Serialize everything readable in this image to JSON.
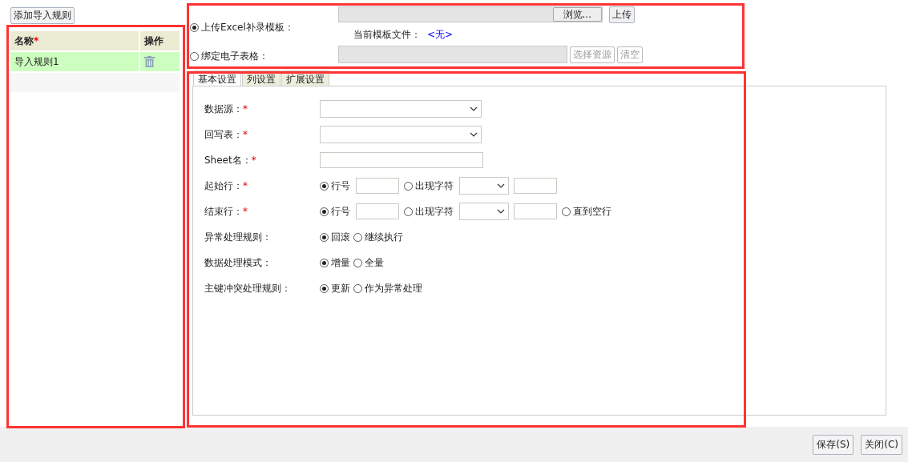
{
  "rules_panel": {
    "add_button": "添加导入规则",
    "columns": [
      {
        "label": "名称",
        "required_mark": "*"
      },
      {
        "label": "操作"
      }
    ],
    "rows": [
      {
        "name": "导入规则1",
        "selected": true
      }
    ]
  },
  "source": {
    "options": [
      {
        "kind": "upload",
        "label": "上传Excel补录模板：",
        "selected": true
      },
      {
        "kind": "bind",
        "label": "绑定电子表格：",
        "selected": false
      }
    ],
    "browse_button": "浏览...",
    "upload_button": "上传",
    "current_file_label": "当前模板文件：",
    "current_file": "<无>",
    "select_button": {
      "label": "选择资源",
      "disabled": true
    },
    "clear_button": {
      "label": "清空",
      "disabled": true
    }
  },
  "tabs": [
    {
      "label": "基本设置",
      "selected": true
    },
    {
      "label": "列设置",
      "selected": false
    },
    {
      "label": "扩展设置",
      "selected": false
    }
  ],
  "fields": [
    {
      "kind": "select",
      "label": "数据源：",
      "required_mark": "*"
    },
    {
      "kind": "select",
      "label": "回写表：",
      "required_mark": "*"
    },
    {
      "kind": "text",
      "label": "Sheet名：",
      "required_mark": "*"
    },
    {
      "kind": "radios",
      "label": "起始行：",
      "required_mark": "*",
      "options": [
        {
          "kind": "number",
          "label": "行号",
          "selected": true
        },
        {
          "kind": "char",
          "label": "出现字符",
          "selected": false
        }
      ]
    },
    {
      "kind": "radios",
      "label": "结束行：",
      "required_mark": "*",
      "options": [
        {
          "kind": "number",
          "label": "行号",
          "selected": true
        },
        {
          "kind": "char",
          "label": "出现字符",
          "selected": false
        },
        {
          "kind": "plain",
          "label": "直到空行",
          "selected": false
        }
      ]
    },
    {
      "kind": "radios",
      "label": "异常处理规则：",
      "options": [
        {
          "kind": "plain",
          "label": "回滚",
          "selected": true
        },
        {
          "kind": "plain",
          "label": "继续执行",
          "selected": false
        }
      ]
    },
    {
      "kind": "radios",
      "label": "数据处理模式：",
      "options": [
        {
          "kind": "plain",
          "label": "增量",
          "selected": true
        },
        {
          "kind": "plain",
          "label": "全量",
          "selected": false
        }
      ]
    },
    {
      "kind": "radios",
      "label": "主键冲突处理规则：",
      "options": [
        {
          "kind": "plain",
          "label": "更新",
          "selected": true
        },
        {
          "kind": "plain",
          "label": "作为异常处理",
          "selected": false
        }
      ]
    }
  ],
  "footer_buttons": [
    "保存(S)",
    "关闭(C)"
  ]
}
